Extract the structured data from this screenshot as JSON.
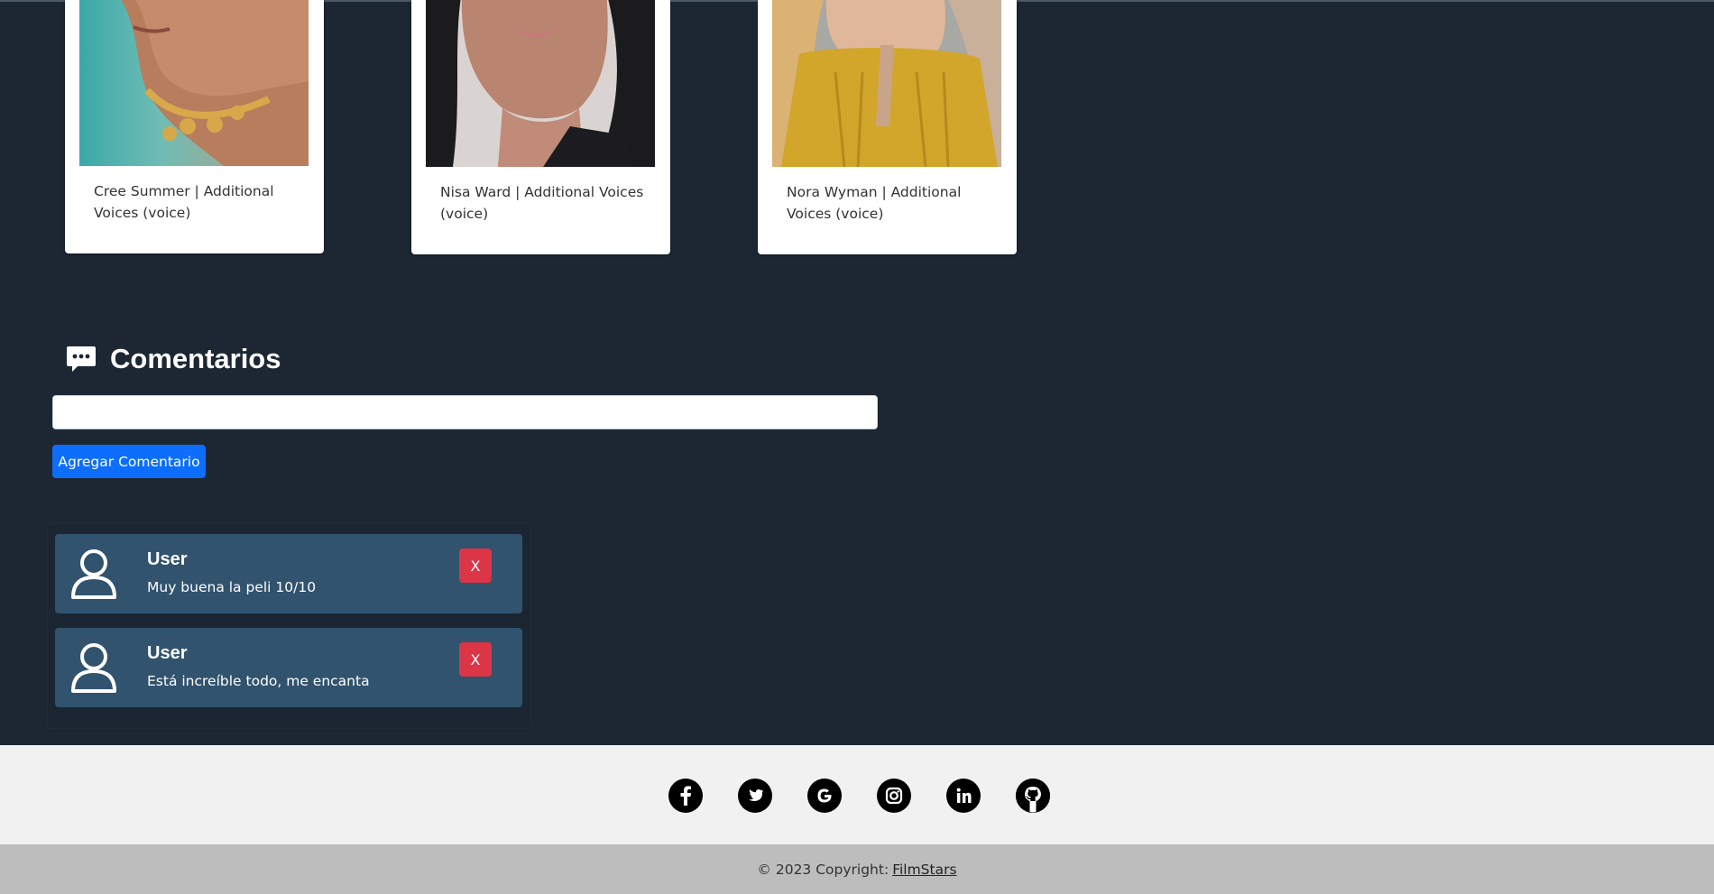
{
  "cast": [
    {
      "caption": "Cree Summer | Additional Voices (voice)"
    },
    {
      "caption": "Nisa Ward | Additional Voices (voice)"
    },
    {
      "caption": "Nora Wyman | Additional Voices (voice)"
    }
  ],
  "comments_section": {
    "title": "Comentarios",
    "input_value": "",
    "input_placeholder": "",
    "add_button_label": "Agregar Comentario",
    "comments": [
      {
        "author": "User",
        "text": "Muy buena la peli 10/10",
        "delete_label": "X"
      },
      {
        "author": "User",
        "text": "Está increíble todo, me encanta",
        "delete_label": "X"
      }
    ]
  },
  "footer": {
    "social_icons": [
      "facebook-icon",
      "twitter-icon",
      "google-icon",
      "instagram-icon",
      "linkedin-icon",
      "github-icon"
    ],
    "copyright_text": "© 2023 Copyright:",
    "copyright_link": "FilmStars"
  },
  "colors": {
    "page_background": "#1c2733",
    "comment_background": "#31536e",
    "primary_button": "#0d6efd",
    "danger_button": "#dc3545"
  }
}
